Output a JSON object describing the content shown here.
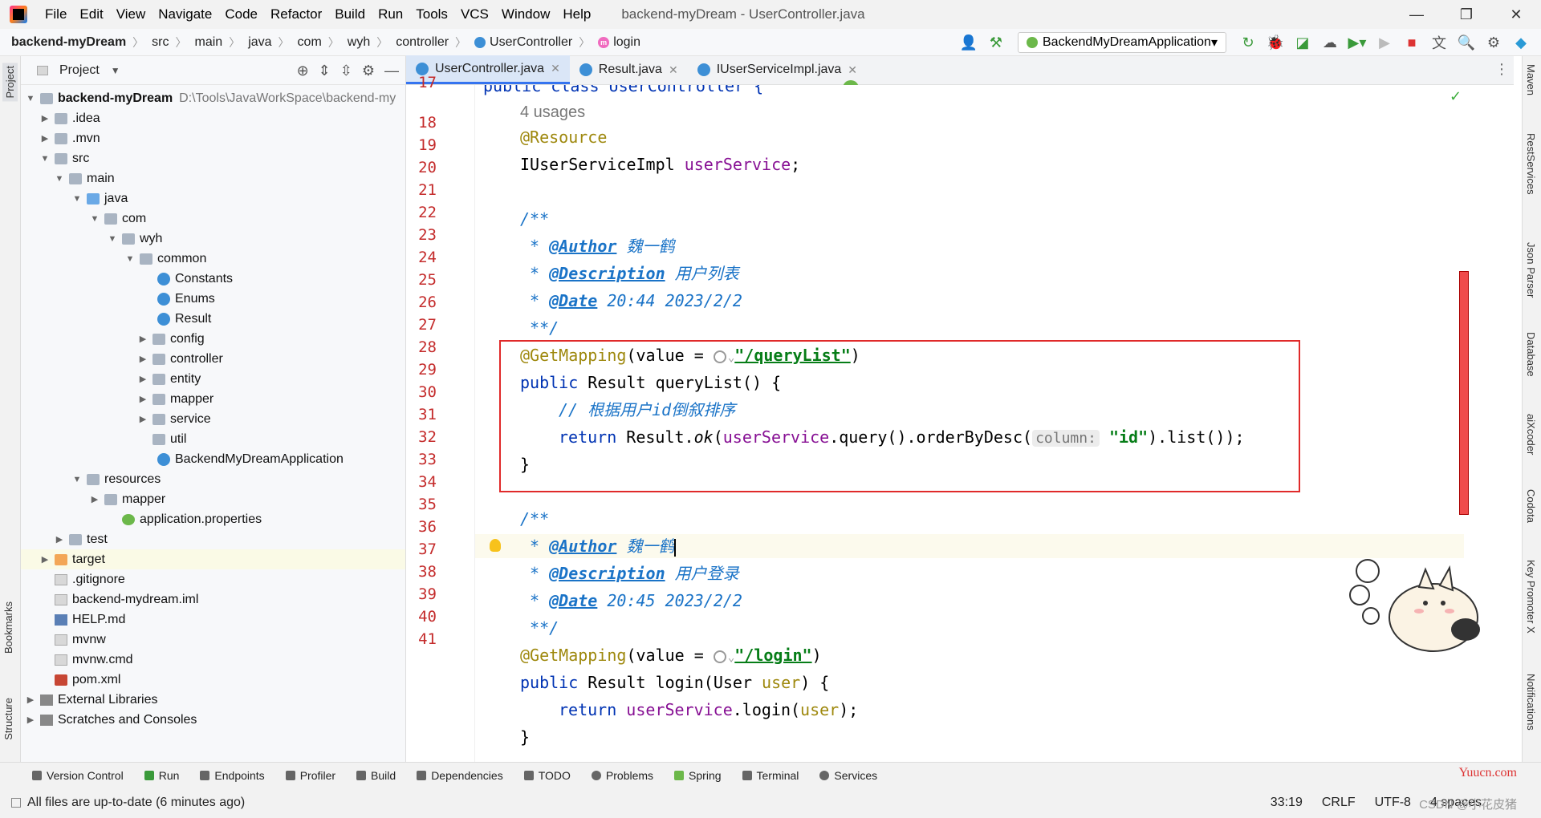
{
  "window": {
    "title": "backend-myDream - UserController.java"
  },
  "menu": [
    "File",
    "Edit",
    "View",
    "Navigate",
    "Code",
    "Refactor",
    "Build",
    "Run",
    "Tools",
    "VCS",
    "Window",
    "Help"
  ],
  "breadcrumbs": [
    "backend-myDream",
    "src",
    "main",
    "java",
    "com",
    "wyh",
    "controller",
    "UserController",
    "login"
  ],
  "run_config": "BackendMyDreamApplication",
  "project_panel": {
    "title": "Project",
    "root_path": "D:\\Tools\\JavaWorkSpace\\backend-my"
  },
  "tree": [
    {
      "label": "backend-myDream",
      "bold": true
    },
    {
      "label": ".idea"
    },
    {
      "label": ".mvn"
    },
    {
      "label": "src"
    },
    {
      "label": "main"
    },
    {
      "label": "java"
    },
    {
      "label": "com"
    },
    {
      "label": "wyh"
    },
    {
      "label": "common"
    },
    {
      "label": "Constants"
    },
    {
      "label": "Enums"
    },
    {
      "label": "Result"
    },
    {
      "label": "config"
    },
    {
      "label": "controller"
    },
    {
      "label": "entity"
    },
    {
      "label": "mapper"
    },
    {
      "label": "service"
    },
    {
      "label": "util"
    },
    {
      "label": "BackendMyDreamApplication"
    },
    {
      "label": "resources"
    },
    {
      "label": "mapper"
    },
    {
      "label": "application.properties"
    },
    {
      "label": "test"
    },
    {
      "label": "target"
    },
    {
      "label": ".gitignore"
    },
    {
      "label": "backend-mydream.iml"
    },
    {
      "label": "HELP.md"
    },
    {
      "label": "mvnw"
    },
    {
      "label": "mvnw.cmd"
    },
    {
      "label": "pom.xml"
    },
    {
      "label": "External Libraries"
    },
    {
      "label": "Scratches and Consoles"
    }
  ],
  "tabs": [
    "UserController.java",
    "Result.java",
    "IUserServiceImpl.java"
  ],
  "line_numbers": [
    "17",
    "18",
    "19",
    "20",
    "21",
    "22",
    "23",
    "24",
    "25",
    "26",
    "27",
    "28",
    "29",
    "30",
    "31",
    "32",
    "33",
    "34",
    "35",
    "36",
    "37",
    "38",
    "39",
    "40",
    "41"
  ],
  "code": {
    "l17": "public class UserController {",
    "usages": "4 usages",
    "l18_ann": "@Resource",
    "l19_type": "IUserServiceImpl ",
    "l19_field": "userService",
    "l19_end": ";",
    "doc_open": "/**",
    "doc_star": " * ",
    "author_tag": "@Author",
    "author_val": " 魏一鹤",
    "desc_tag": "@Description",
    "desc_val1": " 用户列表",
    "date_tag": "@Date",
    "date_val1": " 20:44 2023/2/2",
    "doc_close": " **/",
    "getmapping": "@GetMapping",
    "value_eq": "(value = ",
    "path1": "\"/queryList\"",
    "close_paren": ")",
    "public": "public ",
    "result_type": "Result ",
    "m1": "queryList() {",
    "comment1": "// 根据用户id倒叙排序",
    "return": "return ",
    "l29_a": "Result.",
    "l29_ok": "ok",
    "l29_b": "(",
    "l29_field": "userService",
    "l29_c": ".query().orderByDesc(",
    "hint_column": "column:",
    "l29_str": "\"id\"",
    "l29_d": ").list());",
    "close_brace": "}",
    "desc_val2": " 用户登录",
    "date_val2": " 20:45 2023/2/2",
    "path2": "\"/login\"",
    "m2a": "login(User ",
    "m2p": "user",
    "m2b": ") {",
    "l39_a": ".login(",
    "l39_p": "user",
    "l39_b": ");"
  },
  "right_tools": [
    "Maven",
    "RestServices",
    "Json Parser",
    "Database",
    "aiXcoder",
    "Codota",
    "Key Promoter X",
    "Notifications"
  ],
  "left_tools": [
    "Project",
    "Bookmarks",
    "Structure"
  ],
  "bottom_tools": [
    "Version Control",
    "Run",
    "Endpoints",
    "Profiler",
    "Build",
    "Dependencies",
    "TODO",
    "Problems",
    "Spring",
    "Terminal",
    "Services"
  ],
  "status": {
    "message": "All files are up-to-date (6 minutes ago)",
    "position": "33:19",
    "line_sep": "CRLF",
    "encoding": "UTF-8",
    "indent": "4 spaces"
  },
  "watermark": "Yuucn.com",
  "csdn": "CSDN @小花皮猪"
}
